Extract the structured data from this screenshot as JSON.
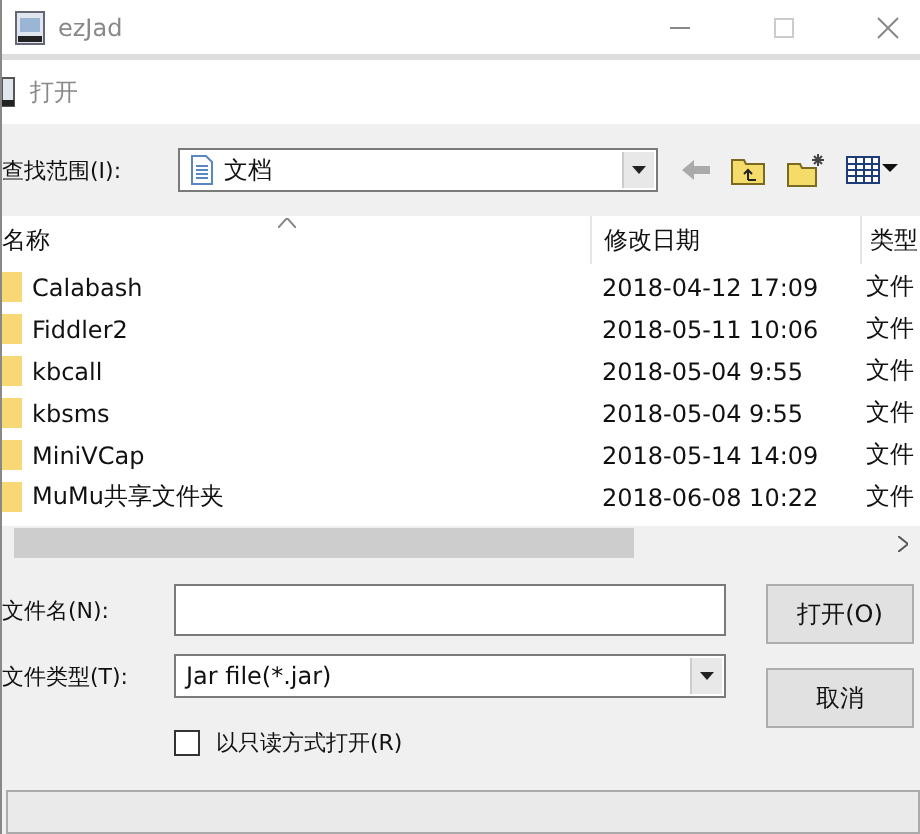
{
  "window": {
    "title": "ezJad"
  },
  "dialog": {
    "title": "打开"
  },
  "look_in": {
    "label": "查找范围(I):",
    "value": "文档"
  },
  "file_list": {
    "columns": [
      "名称",
      "修改日期",
      "类型"
    ],
    "rows": [
      {
        "name": "Calabash",
        "date": "2018-04-12 17:09",
        "type": "文件"
      },
      {
        "name": "Fiddler2",
        "date": "2018-05-11 10:06",
        "type": "文件"
      },
      {
        "name": "kbcall",
        "date": "2018-05-04 9:55",
        "type": "文件"
      },
      {
        "name": "kbsms",
        "date": "2018-05-04 9:55",
        "type": "文件"
      },
      {
        "name": "MiniVCap",
        "date": "2018-05-14 14:09",
        "type": "文件"
      },
      {
        "name": "MuMu共享文件夹",
        "date": "2018-06-08 10:22",
        "type": "文件"
      }
    ]
  },
  "file_name": {
    "label": "文件名(N):"
  },
  "file_type": {
    "label": "文件类型(T):",
    "value": "Jar file(*.jar)"
  },
  "read_only": {
    "label": "以只读方式打开(R)",
    "checked": false
  },
  "buttons": [
    "打开(O)",
    "取消"
  ]
}
